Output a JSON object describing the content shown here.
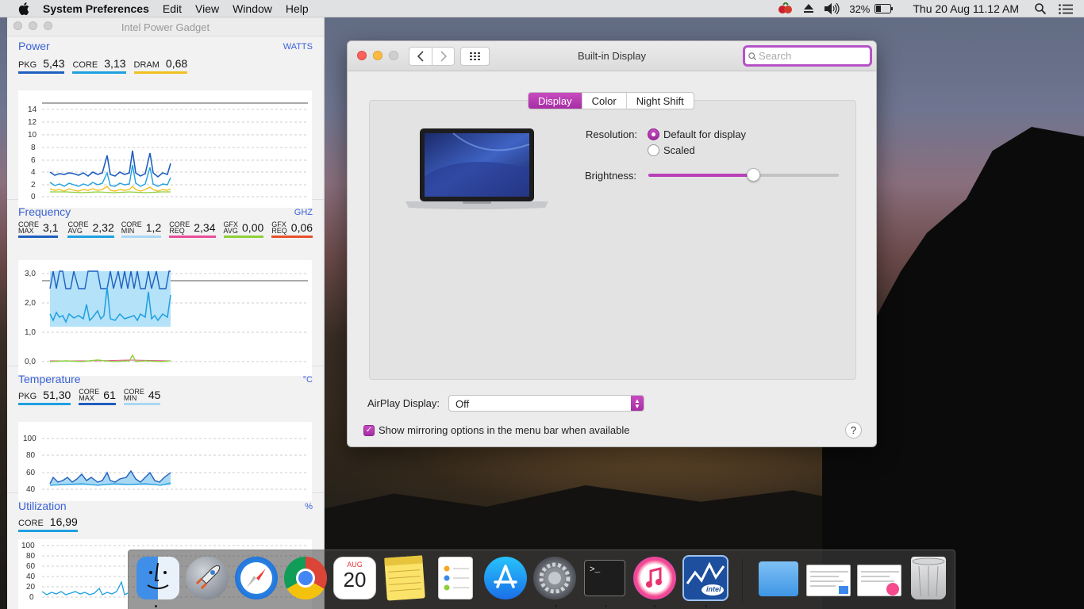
{
  "menubar": {
    "app_name": "System Preferences",
    "items": [
      "Edit",
      "View",
      "Window",
      "Help"
    ],
    "battery": "32%",
    "datetime": "Thu 20 Aug  11.12 AM"
  },
  "gadget": {
    "title": "Intel Power Gadget",
    "power": {
      "heading": "Power",
      "unit": "WATTS",
      "metrics": [
        {
          "label": "PKG",
          "value": "5,43",
          "color": "#1f5fbf"
        },
        {
          "label": "CORE",
          "value": "3,13",
          "color": "#1fa0e0"
        },
        {
          "label": "DRAM",
          "value": "0,68",
          "color": "#f0c020"
        }
      ],
      "y_ticks": [
        "14",
        "12",
        "10",
        "8",
        "6",
        "4",
        "2",
        "0"
      ]
    },
    "frequency": {
      "heading": "Frequency",
      "unit": "GHZ",
      "metrics": [
        {
          "l1": "CORE",
          "l2": "MAX",
          "value": "3,1",
          "color": "#1f5fbf"
        },
        {
          "l1": "CORE",
          "l2": "AVG",
          "value": "2,32",
          "color": "#1fa0e0"
        },
        {
          "l1": "CORE",
          "l2": "MIN",
          "value": "1,2",
          "color": "#a9d8f4"
        },
        {
          "l1": "CORE",
          "l2": "REQ",
          "value": "2,34",
          "color": "#e84d9a"
        },
        {
          "l1": "GFX",
          "l2": "AVG",
          "value": "0,00",
          "color": "#8fcf3c"
        },
        {
          "l1": "GFX",
          "l2": "REQ",
          "value": "0,06",
          "color": "#e8502a"
        }
      ],
      "y_ticks": [
        "3,0",
        "2,0",
        "1,0",
        "0,0"
      ]
    },
    "temperature": {
      "heading": "Temperature",
      "unit": "°C",
      "metrics": [
        {
          "l1": "",
          "l2": "PKG",
          "value": "51,30",
          "color": "#1fa0e0"
        },
        {
          "l1": "CORE",
          "l2": "MAX",
          "value": "61",
          "color": "#1f5fbf"
        },
        {
          "l1": "CORE",
          "l2": "MIN",
          "value": "45",
          "color": "#a9d8f4"
        }
      ],
      "y_ticks": [
        "100",
        "80",
        "60",
        "40"
      ]
    },
    "utilization": {
      "heading": "Utilization",
      "unit": "%",
      "metrics": [
        {
          "label": "CORE",
          "value": "16,99",
          "color": "#1fa0e0"
        }
      ],
      "y_ticks": [
        "100",
        "80",
        "60",
        "40",
        "20",
        "0"
      ]
    }
  },
  "prefs": {
    "title": "Built-in Display",
    "search_placeholder": "Search",
    "tabs": [
      "Display",
      "Color",
      "Night Shift"
    ],
    "resolution_label": "Resolution:",
    "res_default": "Default for display",
    "res_scaled": "Scaled",
    "brightness_label": "Brightness:",
    "brightness_level": 0.55,
    "airplay_label": "AirPlay Display:",
    "airplay_value": "Off",
    "mirror_label": "Show mirroring options in the menu bar when available",
    "help": "?",
    "accent": "#b740b7"
  },
  "dock": {
    "items": [
      "finder-icon",
      "launchpad-icon",
      "safari-icon",
      "chrome-icon",
      "calendar-icon",
      "notes-icon",
      "reminders-icon",
      "app-store-icon",
      "system-preferences-icon",
      "terminal-icon",
      "itunes-icon",
      "power-gadget-icon",
      "downloads-folder-icon",
      "document-icon",
      "document-itunes-icon",
      "trash-icon"
    ],
    "calendar_month": "AUG",
    "calendar_day": "20",
    "terminal_prompt": ">_",
    "gadget_badge": "intel"
  }
}
